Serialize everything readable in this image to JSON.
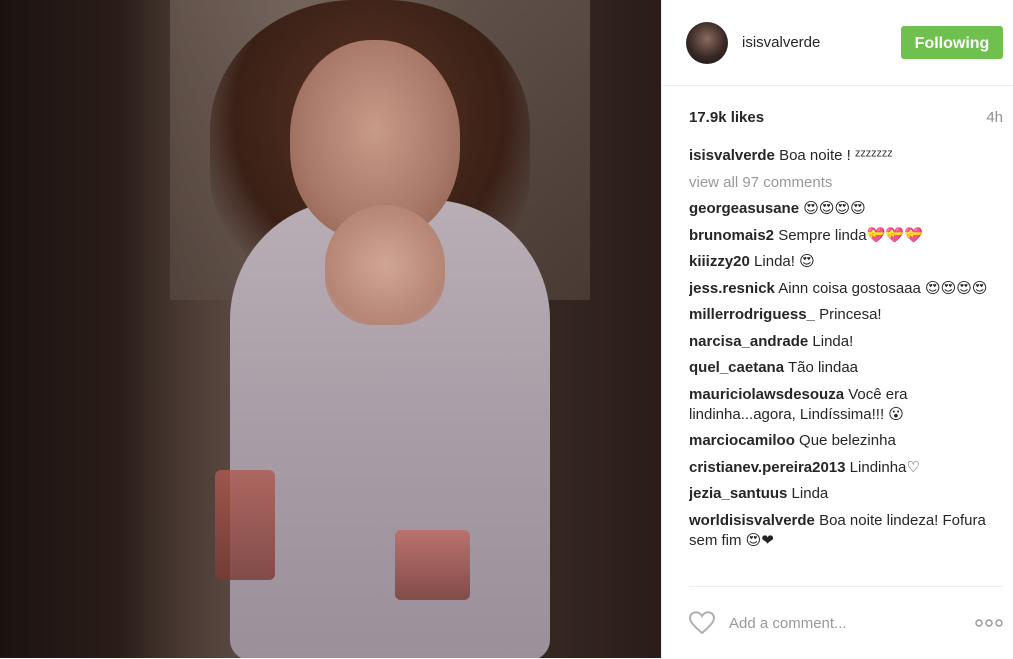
{
  "post": {
    "username": "isisvalverde",
    "follow_label": "Following",
    "likes": "17.9k likes",
    "time": "4h",
    "view_all": "view all 97 comments",
    "comments": [
      {
        "user": "isisvalverde",
        "text": "Boa noite ! ᶻᶻᶻᶻᶻᶻᶻ"
      },
      {
        "user": "georgeasusane",
        "text": "😍😍😍😍"
      },
      {
        "user": "brunomais2",
        "text": "Sempre linda💝💝💝"
      },
      {
        "user": "kiiizzy20",
        "text": "Linda! 😍"
      },
      {
        "user": "jess.resnick",
        "text": "Ainn coisa gostosaaa 😍😍😍😍"
      },
      {
        "user": "millerrodriguess_",
        "text": "Princesa!"
      },
      {
        "user": "narcisa_andrade",
        "text": "Linda!"
      },
      {
        "user": "quel_caetana",
        "text": "Tão lindaa"
      },
      {
        "user": "mauriciolawsdesouza",
        "text": "Você era lindinha...agora, Lindíssima!!! 😮"
      },
      {
        "user": "marciocamiloo",
        "text": "Que belezinha"
      },
      {
        "user": "cristianev.pereira2013",
        "text": "Lindinha♡"
      },
      {
        "user": "jezia_santuus",
        "text": "Linda"
      },
      {
        "user": "worldisisvalverde",
        "text": "Boa noite lindeza! Fofura sem fim 😍❤"
      }
    ],
    "add_comment_placeholder": "Add a comment...",
    "colors": {
      "follow_bg": "#70c050",
      "muted": "#999999"
    },
    "icons": {
      "like": "heart-icon",
      "more": "more-options-icon"
    }
  }
}
